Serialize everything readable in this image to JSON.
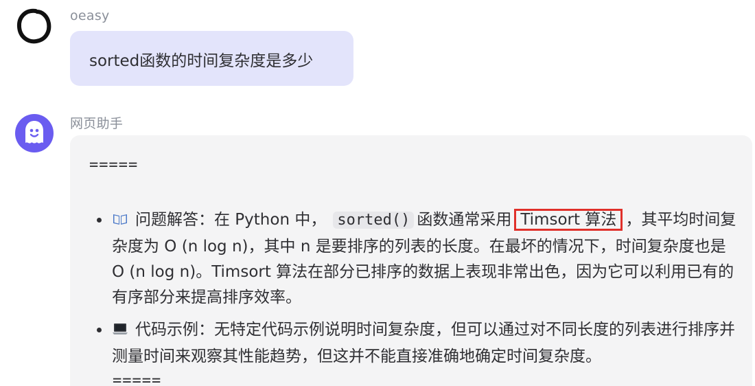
{
  "user_message": {
    "sender": "oeasy",
    "text": "sorted函数的时间复杂度是多少"
  },
  "bot_message": {
    "sender": "网页助手",
    "separator_top": "=====",
    "separator_bottom": "=====",
    "items": [
      {
        "icon": "book-icon",
        "text_prefix": "问题解答：在 Python 中，",
        "code": "sorted()",
        "text_middle": "函数通常采用",
        "highlight": "Timsort 算法",
        "text_suffix": "，其平均时间复杂度为 O (n log n)，其中 n 是要排序的列表的长度。在最坏的情况下，时间复杂度也是 O (n log n)。Timsort 算法在部分已排序的数据上表现非常出色，因为它可以利用已有的有序部分来提高排序效率。"
      },
      {
        "icon": "laptop-icon",
        "text": "代码示例：无特定代码示例说明时间复杂度，但可以通过对不同长度的列表进行排序并测量时间来观察其性能趋势，但这并不能直接准确地确定时间复杂度。"
      }
    ]
  },
  "colors": {
    "user_bubble": "#e3e4fb",
    "bot_bubble": "#f4f4f5",
    "bot_avatar": "#6a5cf0",
    "highlight_border": "#e0302a"
  }
}
